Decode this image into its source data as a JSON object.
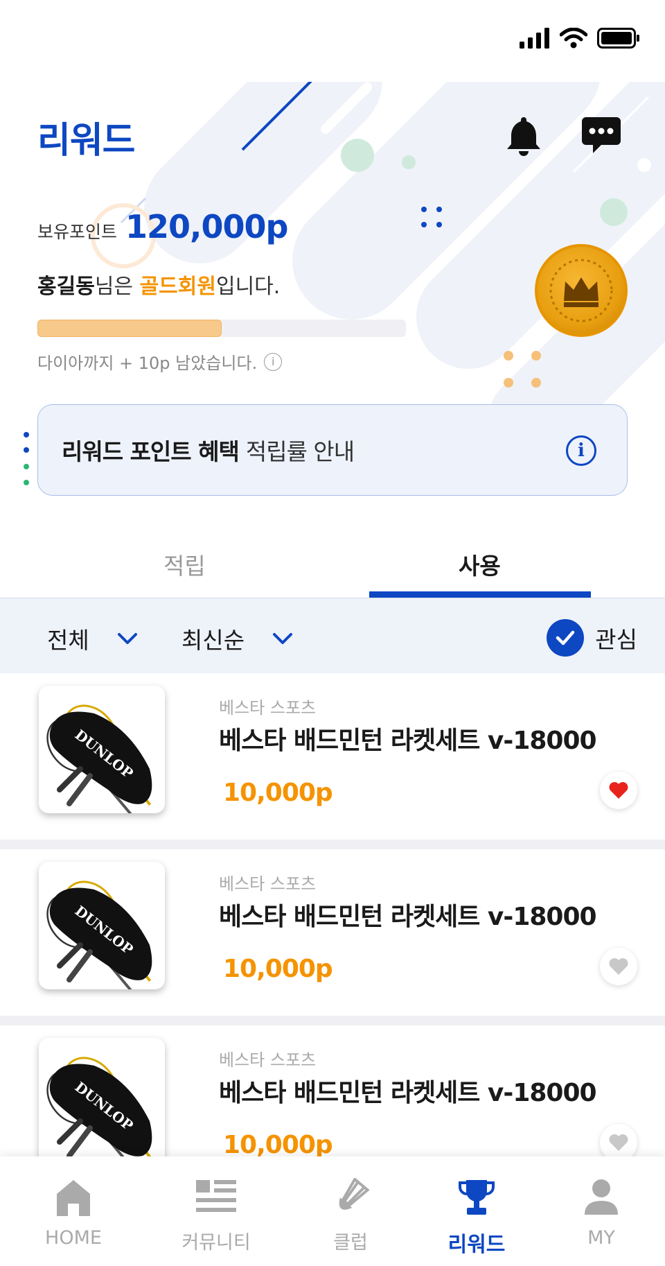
{
  "header": {
    "title": "리워드",
    "bell_icon": "bell-icon",
    "chat_icon": "chat-bubble-icon"
  },
  "points": {
    "label": "보유포인트",
    "value": "120,000p"
  },
  "membership": {
    "name": "홍길동",
    "mid": "님은 ",
    "grade": "골드회원",
    "suffix": "입니다."
  },
  "progress": {
    "fraction": 0.5,
    "note": "다이아까지 + 10p 남았습니다."
  },
  "benefit": {
    "title": "리워드 포인트 혜택",
    "subtitle": "적립률 안내"
  },
  "tabs": [
    {
      "label": "적립",
      "active": false
    },
    {
      "label": "사용",
      "active": true
    }
  ],
  "filters": {
    "category": "전체",
    "sort": "최신순",
    "interest": "관심"
  },
  "products": [
    {
      "brand": "베스타 스포츠",
      "name": "베스타 배드민턴 라켓세트 v-18000",
      "price": "10,000p",
      "liked": true
    },
    {
      "brand": "베스타 스포츠",
      "name": "베스타 배드민턴 라켓세트 v-18000",
      "price": "10,000p",
      "liked": false
    },
    {
      "brand": "베스타 스포츠",
      "name": "베스타 배드민턴 라켓세트 v-18000",
      "price": "10,000p",
      "liked": false
    }
  ],
  "thumb_logo": "DUNLOP",
  "nav": [
    {
      "label": "HOME",
      "icon": "home-icon",
      "active": false
    },
    {
      "label": "커뮤니티",
      "icon": "news-icon",
      "active": false
    },
    {
      "label": "클럽",
      "icon": "shuttlecock-icon",
      "active": false
    },
    {
      "label": "리워드",
      "icon": "trophy-icon",
      "active": true
    },
    {
      "label": "MY",
      "icon": "person-icon",
      "active": false
    }
  ],
  "colors": {
    "primary": "#0d47c2",
    "accent": "#f59300",
    "heart_active": "#e8231c",
    "heart_inactive": "#c8c8c8"
  }
}
